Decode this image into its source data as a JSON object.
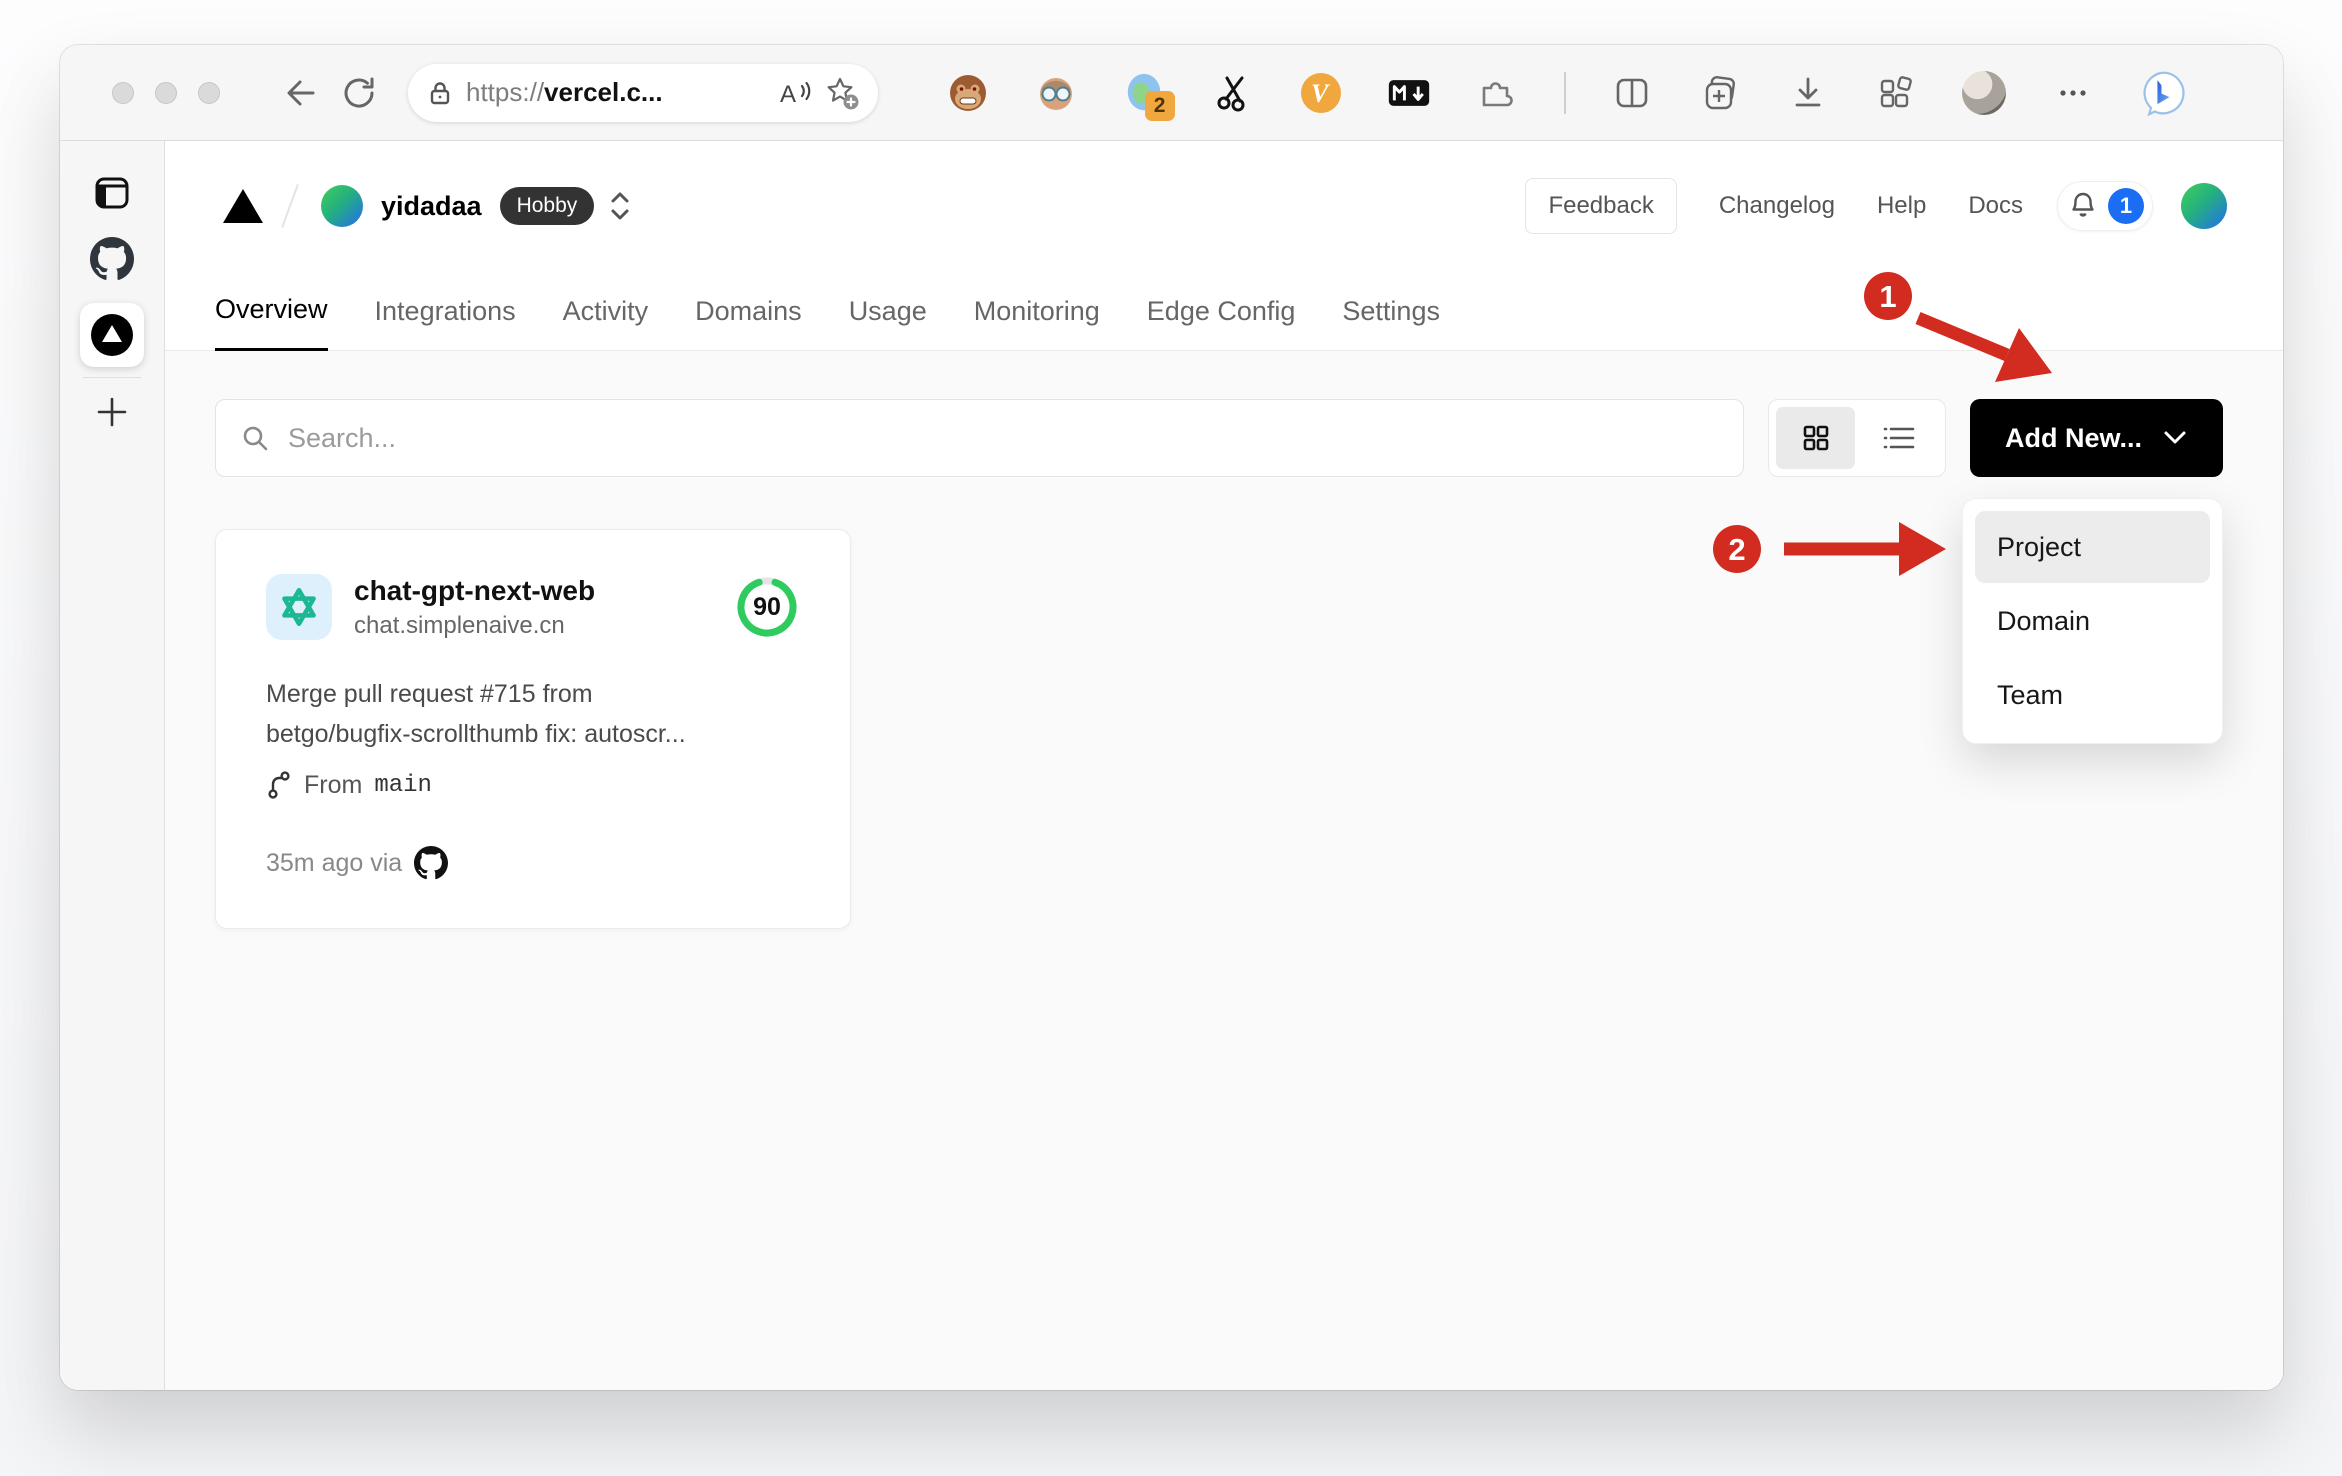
{
  "theme": {
    "accent_red": "#d22b20",
    "badge_blue": "#1b6ef3",
    "success_green": "#2ecc5e",
    "openai_teal": "#1cb894",
    "orange_badge": "#f0a73e"
  },
  "browser": {
    "url": {
      "scheme": "https://",
      "host": "vercel.c..."
    },
    "extension_badge_count": "2",
    "v_extension_label": "V",
    "markdown_extension_label": "M↓"
  },
  "vercel": {
    "team_name": "yidadaa",
    "plan_badge": "Hobby",
    "header_actions": {
      "feedback": "Feedback",
      "changelog": "Changelog",
      "help": "Help",
      "docs": "Docs",
      "notification_count": "1"
    },
    "tabs": [
      {
        "label": "Overview",
        "active": true
      },
      {
        "label": "Integrations",
        "active": false
      },
      {
        "label": "Activity",
        "active": false
      },
      {
        "label": "Domains",
        "active": false
      },
      {
        "label": "Usage",
        "active": false
      },
      {
        "label": "Monitoring",
        "active": false
      },
      {
        "label": "Edge Config",
        "active": false
      },
      {
        "label": "Settings",
        "active": false
      }
    ],
    "controls": {
      "search_placeholder": "Search...",
      "add_new_label": "Add New..."
    },
    "dropdown": {
      "items": [
        {
          "label": "Project",
          "highlighted": true
        },
        {
          "label": "Domain",
          "highlighted": false
        },
        {
          "label": "Team",
          "highlighted": false
        }
      ]
    },
    "project_card": {
      "name": "chat-gpt-next-web",
      "domain": "chat.simplenaive.cn",
      "score": "90",
      "commit_line1": "Merge pull request #715 from",
      "commit_line2": "betgo/bugfix-scrollthumb fix: autoscr...",
      "branch_prefix": "From",
      "branch_name": "main",
      "deploy_meta": "35m ago via"
    }
  },
  "annotations": {
    "step1": "1",
    "step2": "2"
  }
}
